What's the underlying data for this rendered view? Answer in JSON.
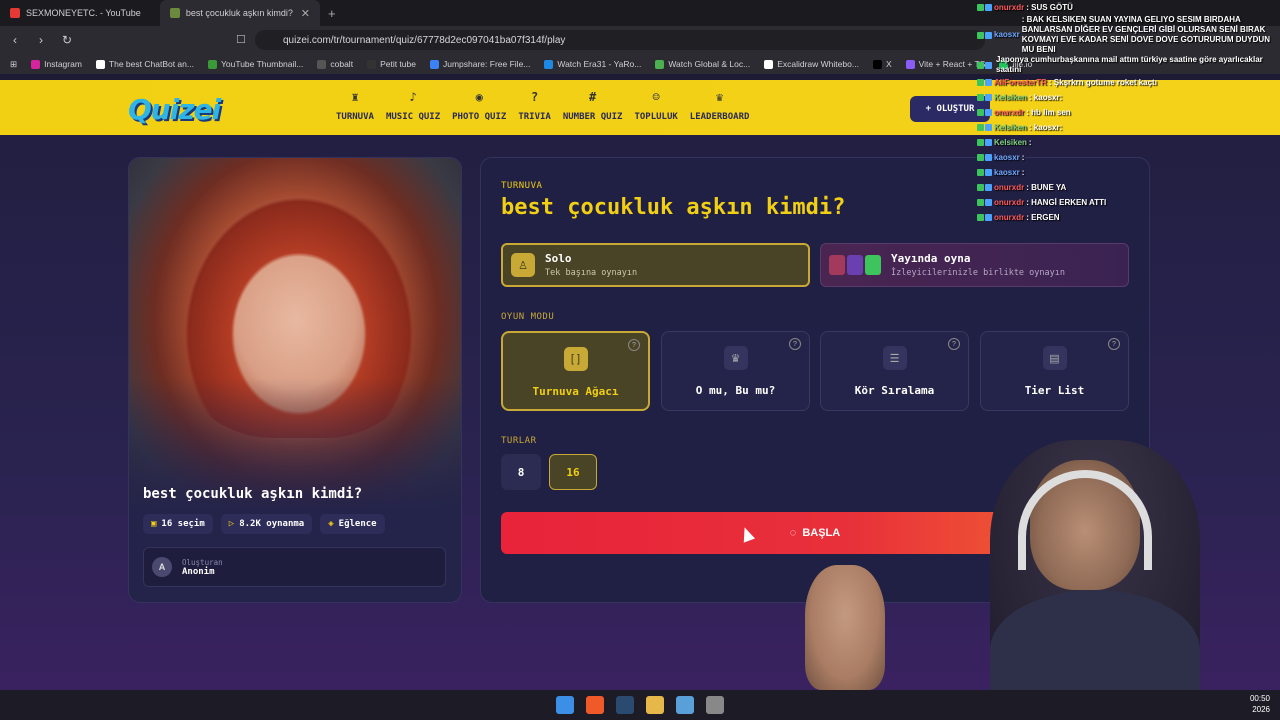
{
  "browser": {
    "tabs": [
      {
        "label": "SEXMONEYETC. - YouTube"
      },
      {
        "label": "best çocukluk aşkın kimdi? - Tie"
      }
    ],
    "url": "quizei.com/tr/tournament/quiz/67778d2ec097041ba07f314f/play",
    "bookmarks": [
      "Instagram",
      "The best ChatBot an...",
      "YouTube Thumbnail...",
      "cobalt",
      "Petit tube",
      "Jumpshare: Free File...",
      "Watch Era31 - YaRo...",
      "Watch Global & Loc...",
      "Excalidraw Whitebo...",
      "X",
      "Vite + React + TS",
      "file.io"
    ]
  },
  "site": {
    "logo": "Quizei",
    "nav": [
      {
        "label": "TURNUVA",
        "icon": "trophy-icon"
      },
      {
        "label": "MUSIC QUIZ",
        "icon": "music-icon"
      },
      {
        "label": "PHOTO QUIZ",
        "icon": "camera-icon"
      },
      {
        "label": "TRIVIA",
        "icon": "question-icon"
      },
      {
        "label": "NUMBER QUIZ",
        "icon": "hash-icon"
      },
      {
        "label": "TOPLULUK",
        "icon": "users-icon"
      },
      {
        "label": "LEADERBOARD",
        "icon": "award-icon"
      }
    ],
    "create_button": "+ OLUŞTUR"
  },
  "quiz": {
    "title": "best çocukluk aşkın kimdi?",
    "stats": {
      "choices": "16 seçim",
      "plays": "8.2K oynanma",
      "category": "Eğlence"
    },
    "creator_label": "Oluşturan",
    "creator_name": "Anonim",
    "creator_initial": "A"
  },
  "panel": {
    "eyebrow": "TURNUVA",
    "title": "best çocukluk aşkın kimdi?",
    "solo": {
      "title": "Solo",
      "subtitle": "Tek başına oynayın"
    },
    "live": {
      "title": "Yayında oyna",
      "subtitle": "İzleyicilerinizle birlikte oynayın"
    },
    "game_mode_label": "OYUN MODU",
    "game_modes": [
      {
        "label": "Turnuva Ağacı",
        "active": true
      },
      {
        "label": "O mu, Bu mu?",
        "active": false
      },
      {
        "label": "Kör Sıralama",
        "active": false
      },
      {
        "label": "Tier List",
        "active": false
      }
    ],
    "rounds_label": "TURLAR",
    "rounds": [
      "8",
      "16"
    ],
    "selected_round": "16",
    "start_button": "BAŞLA"
  },
  "chat": [
    {
      "user": "onurxdr",
      "text": ": SUS GÖTÜ",
      "color": "#ff5a5a"
    },
    {
      "user": "kaosxr",
      "text": ": BAK KELSIKEN SUAN YAYINA GELIYO SESIM BIRDAHA BANLARSAN DİĞER EV GENÇLERİ GİBİ OLURSAN SENİ BIRAK KOVMAYI EVE KADAR SENİ DOVE DOVE GOTURURUM DUYDUN MU BENI",
      "color": "#6ea8ff"
    },
    {
      "user": "",
      "text": "Japonya cumhurbaşkanına mail attım türkiye saatine göre ayarlıcaklar saatini",
      "color": "#fff"
    },
    {
      "user": "AliForesterTR",
      "text": ": Şkşrkrn gotume roket kaçtı",
      "color": "#ff5a5a"
    },
    {
      "user": "Kelsiken",
      "text": ": kaosxr:",
      "color": "#7fd37f"
    },
    {
      "user": "onurxdr",
      "text": ": hb lim sen",
      "color": "#ff5a5a"
    },
    {
      "user": "Kelsiken",
      "text": ": kaosxr:",
      "color": "#7fd37f"
    },
    {
      "user": "Kelsiken",
      "text": ":",
      "color": "#7fd37f"
    },
    {
      "user": "kaosxr",
      "text": ":",
      "color": "#6ea8ff"
    },
    {
      "user": "kaosxr",
      "text": ":",
      "color": "#6ea8ff"
    },
    {
      "user": "onurxdr",
      "text": ": BUNE YA",
      "color": "#ff5a5a"
    },
    {
      "user": "onurxdr",
      "text": ": HANGİ ERKEN ATTI",
      "color": "#ff5a5a"
    },
    {
      "user": "onurxdr",
      "text": ": ERGEN",
      "color": "#ff5a5a"
    }
  ],
  "clock": {
    "time": "00:50",
    "year": "2026"
  }
}
